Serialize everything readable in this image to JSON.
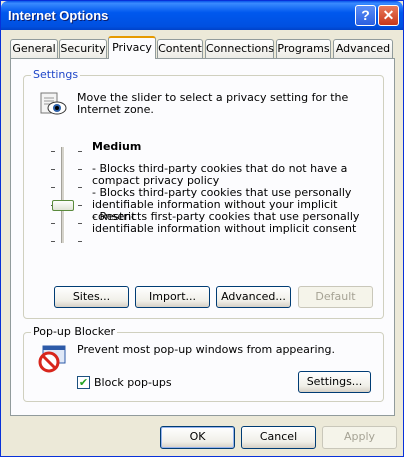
{
  "window": {
    "title": "Internet Options",
    "help_label": "?",
    "close_label": "✕"
  },
  "tabs": [
    {
      "label": "General"
    },
    {
      "label": "Security"
    },
    {
      "label": "Privacy"
    },
    {
      "label": "Content"
    },
    {
      "label": "Connections"
    },
    {
      "label": "Programs"
    },
    {
      "label": "Advanced"
    }
  ],
  "active_tab": "Privacy",
  "settings": {
    "group_label": "Settings",
    "instruction": "Move the slider to select a privacy setting for the Internet zone.",
    "level_name": "Medium",
    "slider_level": "Medium",
    "description": [
      "- Blocks third-party cookies that do not have a compact privacy policy",
      "- Blocks third-party cookies that use personally identifiable information without your implicit consent",
      "- Restricts first-party cookies that use personally identifiable information without implicit consent"
    ],
    "buttons": {
      "sites": "Sites...",
      "import": "Import...",
      "advanced": "Advanced...",
      "default": "Default"
    }
  },
  "popup_blocker": {
    "group_label": "Pop-up Blocker",
    "description": "Prevent most pop-up windows from appearing.",
    "checkbox_label": "Block pop-ups",
    "checkbox_checked": true,
    "settings_button": "Settings..."
  },
  "footer": {
    "ok": "OK",
    "cancel": "Cancel",
    "apply": "Apply"
  }
}
